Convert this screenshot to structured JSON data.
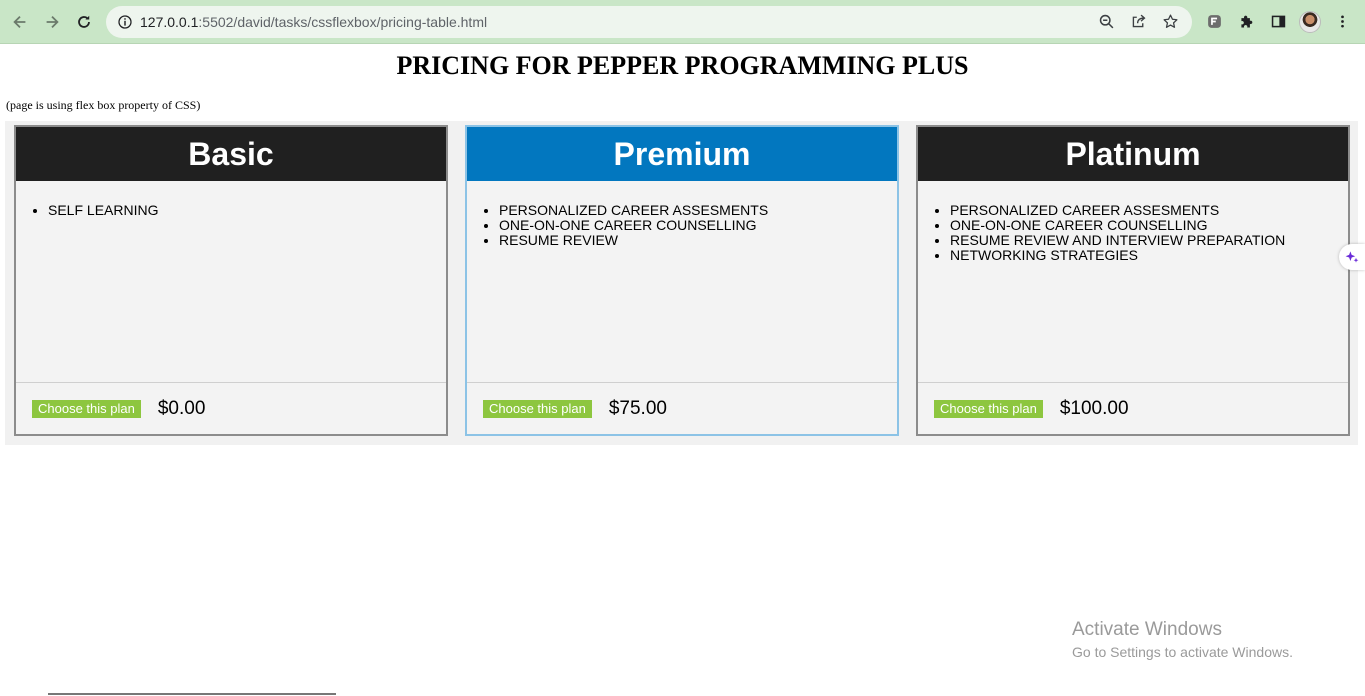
{
  "browser": {
    "url_host": "127.0.0.1",
    "url_path": ":5502/david/tasks/cssflexbox/pricing-table.html",
    "icons": {
      "back": "arrow-left-icon",
      "forward": "arrow-right-icon",
      "reload": "reload-icon",
      "info": "info-icon",
      "zoom": "zoom-icon",
      "share": "share-icon",
      "bookmark": "star-icon",
      "extension1": "extension-app-icon",
      "extensions": "puzzle-icon",
      "sidepanel": "side-panel-icon",
      "profile": "avatar",
      "menu": "kebab-menu-icon"
    },
    "chrome_color": "#c9e6c7"
  },
  "page": {
    "title": "PRICING FOR PEPPER PROGRAMMING PLUS",
    "note": "(page is using flex box property of CSS)",
    "plans": [
      {
        "name": "Basic",
        "header_color": "#202020",
        "features": [
          "SELF LEARNING"
        ],
        "button_label": "Choose this plan",
        "price": "$0.00"
      },
      {
        "name": "Premium",
        "header_color": "#0277bf",
        "features": [
          "PERSONALIZED CAREER ASSESMENTS",
          "ONE-ON-ONE CAREER COUNSELLING",
          "RESUME REVIEW"
        ],
        "button_label": "Choose this plan",
        "price": "$75.00"
      },
      {
        "name": "Platinum",
        "header_color": "#202020",
        "features": [
          "PERSONALIZED CAREER ASSESMENTS",
          "ONE-ON-ONE CAREER COUNSELLING",
          "RESUME REVIEW AND INTERVIEW PREPARATION",
          "NETWORKING STRATEGIES"
        ],
        "button_label": "Choose this plan",
        "price": "$100.00"
      }
    ],
    "button_color": "#8dc63f"
  },
  "watermark": {
    "line1": "Activate Windows",
    "line2": "Go to Settings to activate Windows."
  }
}
